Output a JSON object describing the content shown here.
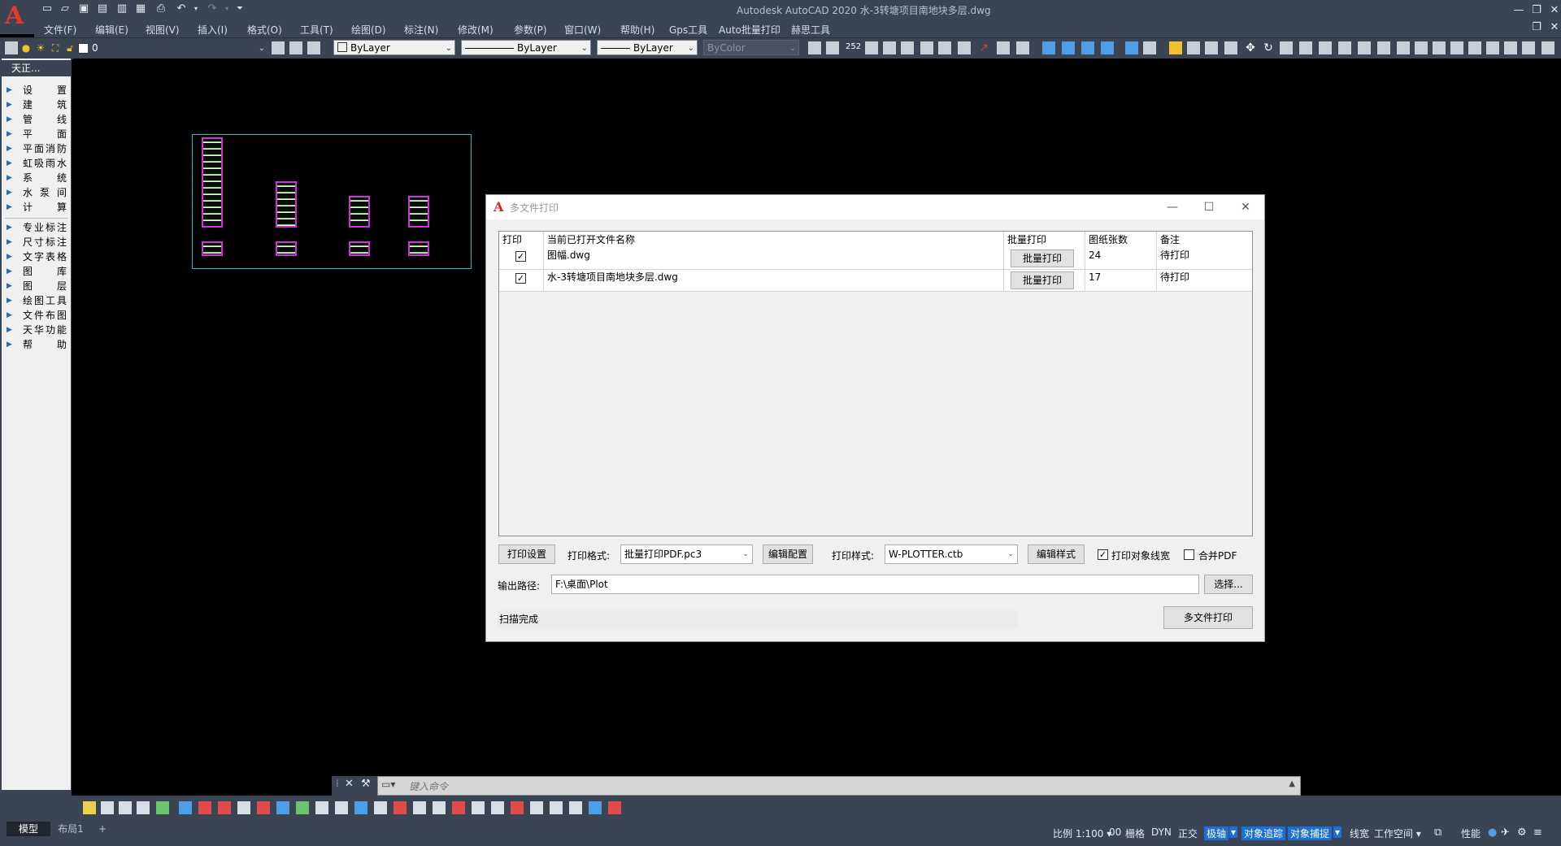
{
  "app": {
    "title": "Autodesk AutoCAD 2020    水-3转塘项目南地块多层.dwg",
    "logo_letter": "A"
  },
  "menus": [
    "文件(F)",
    "编辑(E)",
    "视图(V)",
    "插入(I)",
    "格式(O)",
    "工具(T)",
    "绘图(D)",
    "标注(N)",
    "修改(M)",
    "参数(P)",
    "窗口(W)",
    "帮助(H)",
    "Gps工具",
    "Auto批量打印",
    "赫思工具"
  ],
  "toolbar": {
    "layer_value": "0",
    "color_value": "ByLayer",
    "linetype_value": "ByLayer",
    "lineweight_value": "ByLayer",
    "plotstyle_value": "ByColor",
    "dim_text": "252"
  },
  "palette": {
    "title": "天正...",
    "items": [
      "设　置",
      "建　筑",
      "管　线",
      "平　面",
      "平面消防",
      "虹吸雨水",
      "系　统",
      "水 泵 间",
      "计　算",
      "专业标注",
      "尺寸标注",
      "文字表格",
      "图　库",
      "图　层",
      "绘图工具",
      "文件布图",
      "天华功能",
      "帮　助"
    ]
  },
  "dialog": {
    "title": "多文件打印",
    "columns": [
      "打印",
      "当前已打开文件名称",
      "批量打印",
      "图纸张数",
      "备注"
    ],
    "rows": [
      {
        "checked": true,
        "filename": "图幅.dwg",
        "button": "批量打印",
        "count": "24",
        "note": "待打印"
      },
      {
        "checked": true,
        "filename": "水-3转塘项目南地块多层.dwg",
        "button": "批量打印",
        "count": "17",
        "note": "待打印"
      }
    ],
    "print_settings_button": "打印设置",
    "print_format_label": "打印格式:",
    "print_format_value": "批量打印PDF.pc3",
    "edit_config_button": "编辑配置",
    "print_style_label": "打印样式:",
    "print_style_value": "W-PLOTTER.ctb",
    "edit_style_button": "编辑样式",
    "print_lineweight_label": "打印对象线宽",
    "print_lineweight_checked": true,
    "merge_pdf_label": "合并PDF",
    "merge_pdf_checked": false,
    "output_path_label": "输出路径:",
    "output_path_value": "F:\\桌面\\Plot",
    "choose_button": "选择...",
    "status_text": "扫描完成",
    "multi_print_button": "多文件打印"
  },
  "command_line": {
    "placeholder": "键入命令"
  },
  "layout_tabs": {
    "model": "模型",
    "layout1": "布局1",
    "add": "+"
  },
  "statusbar": {
    "scale": "比例 1:100",
    "value_00": "00",
    "grid": "栅格",
    "dyn": "DYN",
    "ortho": "正交",
    "polar": "极轴",
    "otrack": "对象追踪",
    "osnap": "对象捕捉",
    "lineweight": "线宽",
    "workspace": "工作空间",
    "performance": "性能"
  },
  "colors": {
    "chrome": "#3b4453",
    "accent": "#1b6fd6",
    "frame": "#1fc9c2",
    "sheet": "#d230d8"
  }
}
